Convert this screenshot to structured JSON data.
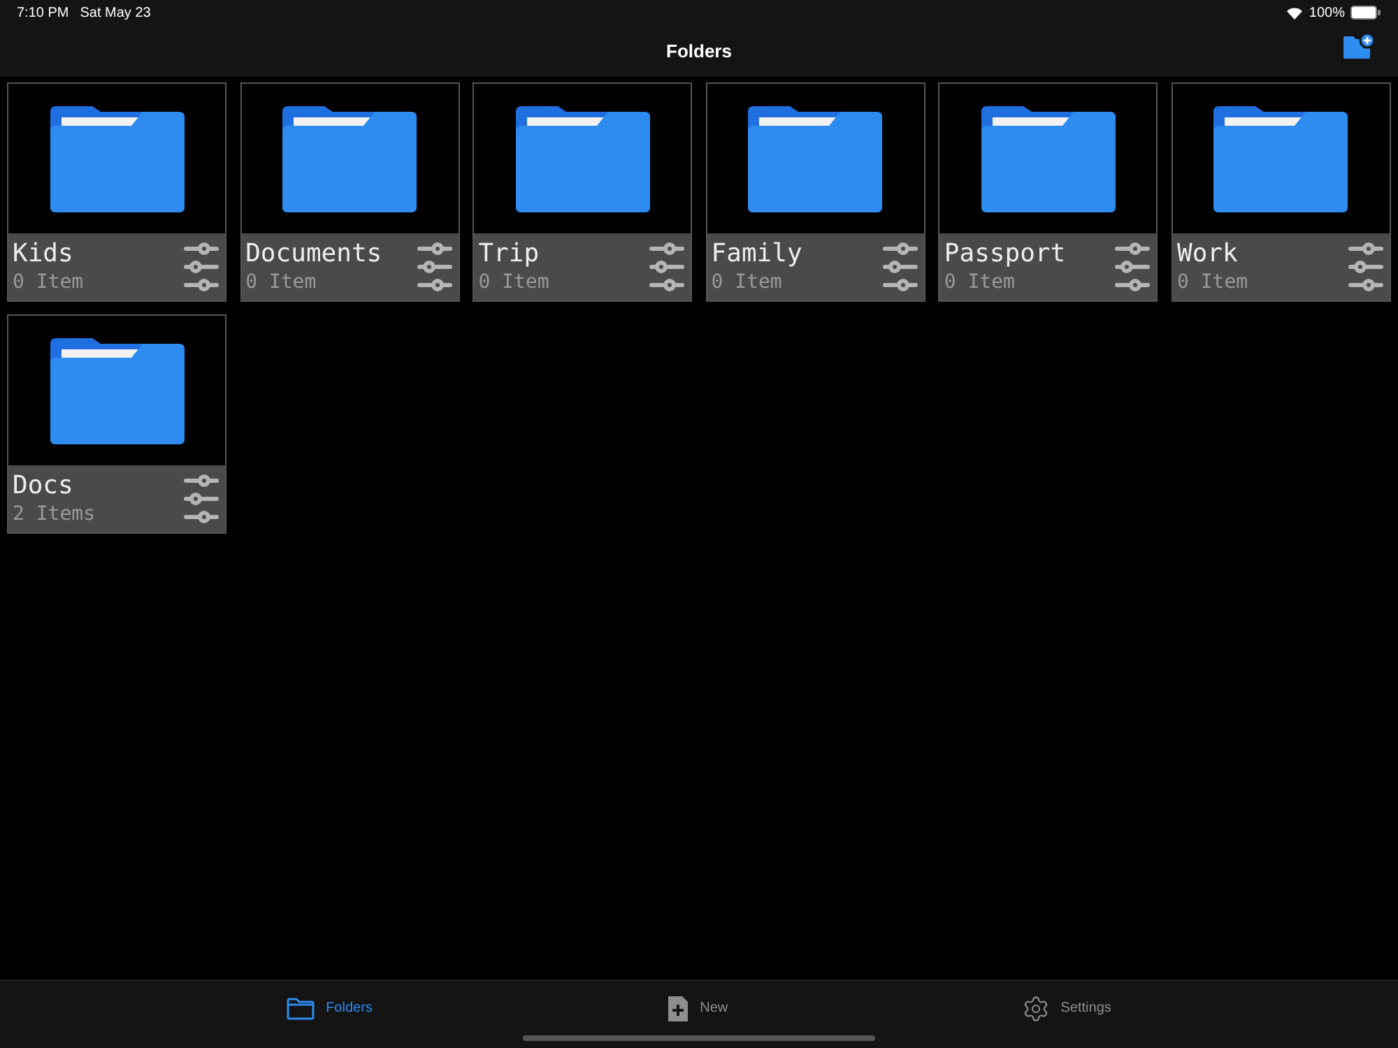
{
  "status_bar": {
    "time": "7:10 PM",
    "date": "Sat May 23",
    "battery": "100%"
  },
  "nav": {
    "title": "Folders"
  },
  "folders": [
    {
      "name": "Kids",
      "count": "0 Item"
    },
    {
      "name": "Documents",
      "count": "0 Item"
    },
    {
      "name": "Trip",
      "count": "0 Item"
    },
    {
      "name": "Family",
      "count": "0 Item"
    },
    {
      "name": "Passport",
      "count": "0 Item"
    },
    {
      "name": "Work",
      "count": "0 Item"
    },
    {
      "name": "Docs",
      "count": "2 Items"
    }
  ],
  "tabs": [
    {
      "label": "Folders",
      "kind": "folders",
      "selected": true
    },
    {
      "label": "New",
      "kind": "new",
      "selected": false
    },
    {
      "label": "Settings",
      "kind": "settings",
      "selected": false
    }
  ]
}
